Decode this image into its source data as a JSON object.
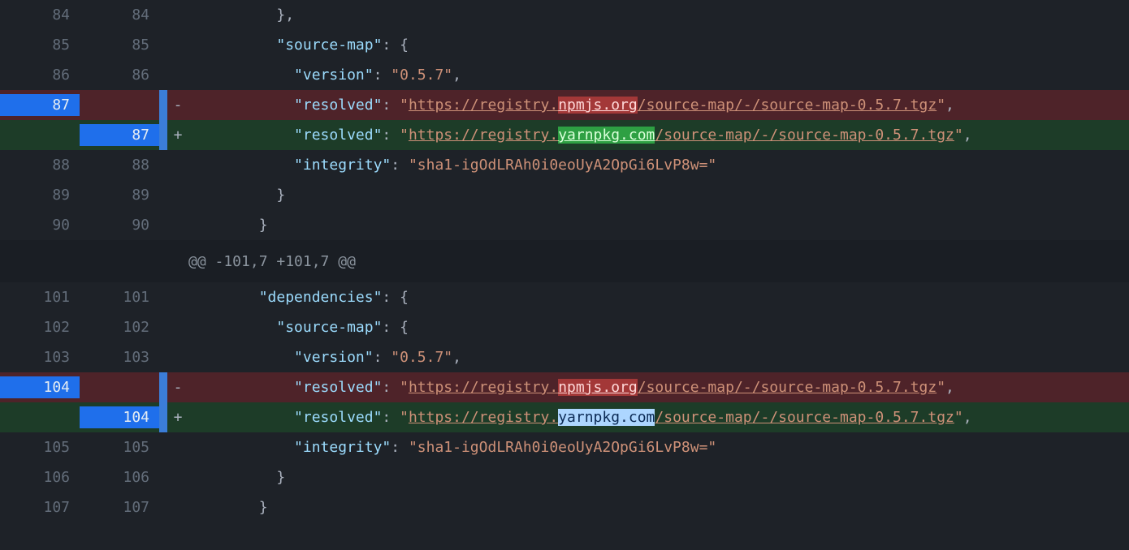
{
  "hunk_header_2": "@@ -101,7 +101,7 @@",
  "rows": [
    {
      "old": "84",
      "new": "84",
      "type": "ctx",
      "indent": "          ",
      "code": [
        {
          "t": "punc",
          "v": "},"
        }
      ]
    },
    {
      "old": "85",
      "new": "85",
      "type": "ctx",
      "indent": "          ",
      "code": [
        {
          "t": "key",
          "v": "\"source-map\""
        },
        {
          "t": "punc",
          "v": ": {"
        }
      ]
    },
    {
      "old": "86",
      "new": "86",
      "type": "ctx",
      "indent": "            ",
      "code": [
        {
          "t": "key",
          "v": "\"version\""
        },
        {
          "t": "punc",
          "v": ": "
        },
        {
          "t": "str",
          "v": "\"0.5.7\""
        },
        {
          "t": "punc",
          "v": ","
        }
      ]
    },
    {
      "old": "87",
      "new": "",
      "type": "del",
      "indent": "            ",
      "code": [
        {
          "t": "key",
          "v": "\"resolved\""
        },
        {
          "t": "punc",
          "v": ": "
        },
        {
          "t": "str",
          "v": "\""
        },
        {
          "t": "url",
          "v": "https://registry."
        },
        {
          "t": "wdel",
          "v": "npmjs.org"
        },
        {
          "t": "url",
          "v": "/source-map/-/source-map-0.5.7.tgz"
        },
        {
          "t": "str",
          "v": "\""
        },
        {
          "t": "punc",
          "v": ","
        }
      ]
    },
    {
      "old": "",
      "new": "87",
      "type": "add",
      "indent": "            ",
      "code": [
        {
          "t": "key",
          "v": "\"resolved\""
        },
        {
          "t": "punc",
          "v": ": "
        },
        {
          "t": "str",
          "v": "\""
        },
        {
          "t": "url",
          "v": "https://registry."
        },
        {
          "t": "wadd",
          "v": "yarnpkg.com"
        },
        {
          "t": "url",
          "v": "/source-map/-/source-map-0.5.7.tgz"
        },
        {
          "t": "str",
          "v": "\""
        },
        {
          "t": "punc",
          "v": ","
        }
      ]
    },
    {
      "old": "88",
      "new": "88",
      "type": "ctx",
      "indent": "            ",
      "code": [
        {
          "t": "key",
          "v": "\"integrity\""
        },
        {
          "t": "punc",
          "v": ": "
        },
        {
          "t": "str",
          "v": "\"sha1-igOdLRAh0i0eoUyA2OpGi6LvP8w=\""
        }
      ]
    },
    {
      "old": "89",
      "new": "89",
      "type": "ctx",
      "indent": "          ",
      "code": [
        {
          "t": "punc",
          "v": "}"
        }
      ]
    },
    {
      "old": "90",
      "new": "90",
      "type": "ctx",
      "indent": "        ",
      "code": [
        {
          "t": "punc",
          "v": "}"
        }
      ]
    },
    {
      "type": "hunk"
    },
    {
      "old": "101",
      "new": "101",
      "type": "ctx",
      "indent": "        ",
      "code": [
        {
          "t": "key",
          "v": "\"dependencies\""
        },
        {
          "t": "punc",
          "v": ": {"
        }
      ]
    },
    {
      "old": "102",
      "new": "102",
      "type": "ctx",
      "indent": "          ",
      "code": [
        {
          "t": "key",
          "v": "\"source-map\""
        },
        {
          "t": "punc",
          "v": ": {"
        }
      ]
    },
    {
      "old": "103",
      "new": "103",
      "type": "ctx",
      "indent": "            ",
      "code": [
        {
          "t": "key",
          "v": "\"version\""
        },
        {
          "t": "punc",
          "v": ": "
        },
        {
          "t": "str",
          "v": "\"0.5.7\""
        },
        {
          "t": "punc",
          "v": ","
        }
      ]
    },
    {
      "old": "104",
      "new": "",
      "type": "del",
      "indent": "            ",
      "code": [
        {
          "t": "key",
          "v": "\"resolved\""
        },
        {
          "t": "punc",
          "v": ": "
        },
        {
          "t": "str",
          "v": "\""
        },
        {
          "t": "url",
          "v": "https://registry."
        },
        {
          "t": "wdel",
          "v": "npmjs.org"
        },
        {
          "t": "url",
          "v": "/source-map/-/source-map-0.5.7.tgz"
        },
        {
          "t": "str",
          "v": "\""
        },
        {
          "t": "punc",
          "v": ","
        }
      ]
    },
    {
      "old": "",
      "new": "104",
      "type": "add",
      "indent": "            ",
      "code": [
        {
          "t": "key",
          "v": "\"resolved\""
        },
        {
          "t": "punc",
          "v": ": "
        },
        {
          "t": "str",
          "v": "\""
        },
        {
          "t": "url",
          "v": "https://registry."
        },
        {
          "t": "wsel",
          "v": "yarnpkg.com"
        },
        {
          "t": "url",
          "v": "/source-map/-/source-map-0.5.7.tgz"
        },
        {
          "t": "str",
          "v": "\""
        },
        {
          "t": "punc",
          "v": ","
        }
      ]
    },
    {
      "old": "105",
      "new": "105",
      "type": "ctx",
      "indent": "            ",
      "code": [
        {
          "t": "key",
          "v": "\"integrity\""
        },
        {
          "t": "punc",
          "v": ": "
        },
        {
          "t": "str",
          "v": "\"sha1-igOdLRAh0i0eoUyA2OpGi6LvP8w=\""
        }
      ]
    },
    {
      "old": "106",
      "new": "106",
      "type": "ctx",
      "indent": "          ",
      "code": [
        {
          "t": "punc",
          "v": "}"
        }
      ]
    },
    {
      "old": "107",
      "new": "107",
      "type": "ctx",
      "indent": "        ",
      "code": [
        {
          "t": "punc",
          "v": "}"
        }
      ]
    }
  ]
}
